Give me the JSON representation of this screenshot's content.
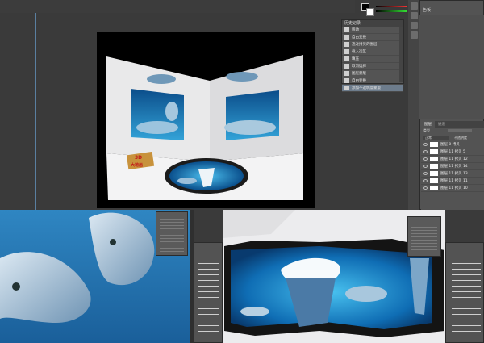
{
  "history_panel": {
    "title": "历史记录",
    "items": [
      "移动",
      "自由变换",
      "通过拷贝的图层",
      "载入选区",
      "填充",
      "取消选择",
      "图层蒙版",
      "自由变换",
      "添加不透明度蒙版"
    ]
  },
  "color_panel": {
    "tab": "调整",
    "label": "色板"
  },
  "layers_panel": {
    "tabs": [
      "图层",
      "通道"
    ],
    "kind_label": "类型",
    "blend_mode": "正常",
    "opacity_label": "不透明度",
    "layers": [
      "图层 0 拷贝",
      "图层 11 拷贝 5",
      "图层 11 拷贝 12",
      "图层 11 拷贝 14",
      "图层 11 拷贝 13",
      "图层 11 拷贝 11",
      "图层 11 拷贝 10"
    ]
  },
  "poster": {
    "sign_line1": "3D",
    "sign_line2": "大地画"
  },
  "colors": {
    "app_bg": "#535353",
    "workspace": "#3a3a3a",
    "selection": "#6d7c8c"
  }
}
